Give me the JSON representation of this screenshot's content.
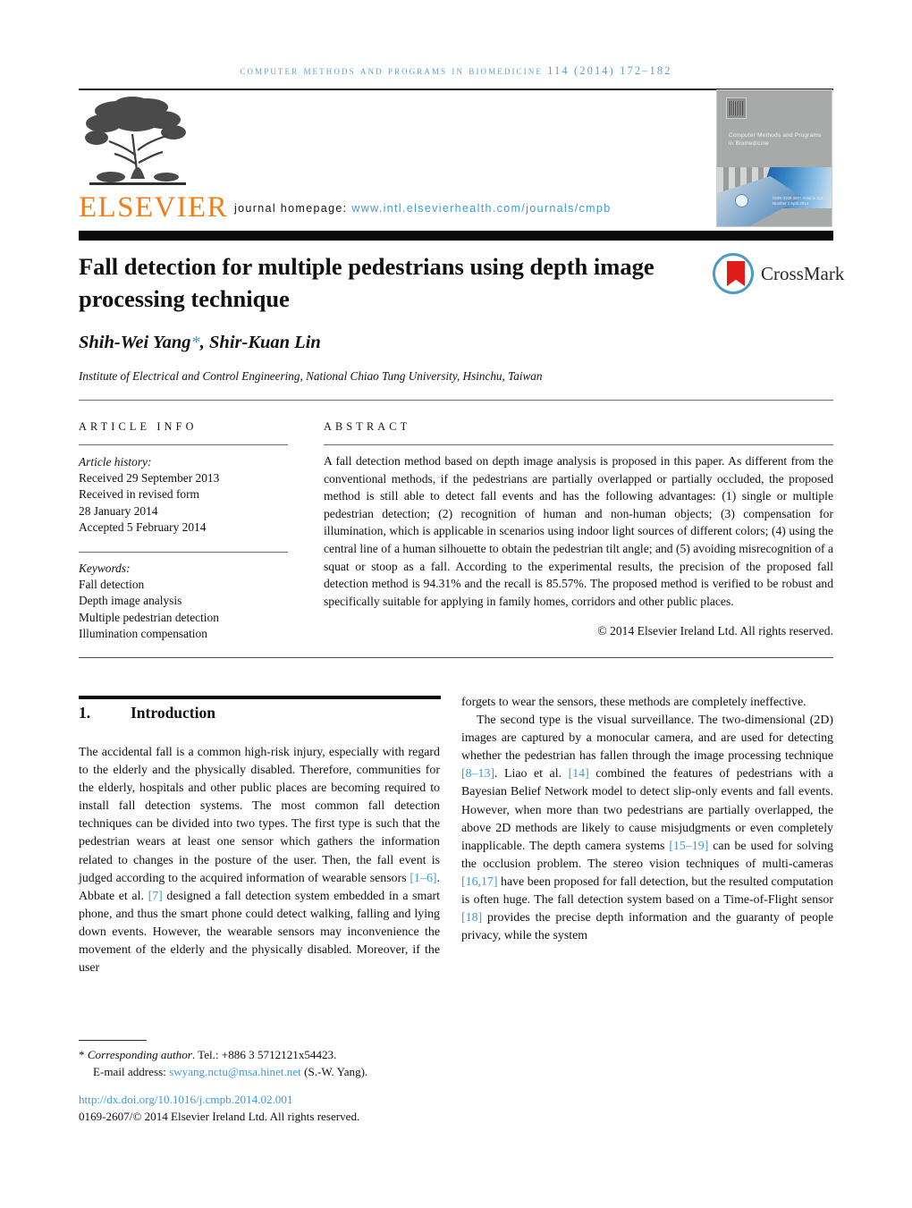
{
  "running_head": "Computer methods and programs in biomedicine 114 (2014) 172–182",
  "header": {
    "publisher": "ELSEVIER",
    "homepage_label": "journal homepage:",
    "homepage_url": "www.intl.elsevierhealth.com/journals/cmpb",
    "cover": {
      "title": "Computer Methods and Programs in Biomedicine",
      "footer": "ISSN 0169-2607 Volume 114 Number 1 April 2014"
    }
  },
  "article": {
    "title": "Fall detection for multiple pedestrians using depth image processing technique",
    "crossmark_label": "CrossMark",
    "authors": "Shih-Wei Yang",
    "authors_star": "*",
    "authors_rest": ", Shir-Kuan Lin",
    "affiliation": "Institute of Electrical and Control Engineering, National Chiao Tung University, Hsinchu, Taiwan"
  },
  "info": {
    "heading": "ARTICLE INFO",
    "history_label": "Article history:",
    "history": [
      "Received 29 September 2013",
      "Received in revised form",
      "28 January 2014",
      "Accepted 5 February 2014"
    ],
    "keywords_label": "Keywords:",
    "keywords": [
      "Fall detection",
      "Depth image analysis",
      "Multiple pedestrian detection",
      "Illumination compensation"
    ]
  },
  "abstract": {
    "heading": "ABSTRACT",
    "text": "A fall detection method based on depth image analysis is proposed in this paper. As different from the conventional methods, if the pedestrians are partially overlapped or partially occluded, the proposed method is still able to detect fall events and has the following advantages: (1) single or multiple pedestrian detection; (2) recognition of human and non-human objects; (3) compensation for illumination, which is applicable in scenarios using indoor light sources of different colors; (4) using the central line of a human silhouette to obtain the pedestrian tilt angle; and (5) avoiding misrecognition of a squat or stoop as a fall. According to the experimental results, the precision of the proposed fall detection method is 94.31% and the recall is 85.57%. The proposed method is verified to be robust and specifically suitable for applying in family homes, corridors and other public places.",
    "copyright": "© 2014 Elsevier Ireland Ltd. All rights reserved."
  },
  "body": {
    "section_number": "1.",
    "section_title": "Introduction",
    "left_text": "The accidental fall is a common high-risk injury, especially with regard to the elderly and the physically disabled. Therefore, communities for the elderly, hospitals and other public places are becoming required to install fall detection systems. The most common fall detection techniques can be divided into two types. The first type is such that the pedestrian wears at least one sensor which gathers the information related to changes in the posture of the user. Then, the fall event is judged according to the acquired information of wearable sensors ",
    "left_cite_1": "[1–6]",
    "left_text_2": ". Abbate et al. ",
    "left_cite_2": "[7]",
    "left_text_3": " designed a fall detection system embedded in a smart phone, and thus the smart phone could detect walking, falling and lying down events. However, the wearable sensors may inconvenience the movement of the elderly and the physically disabled. Moreover, if the user",
    "right_p1": "forgets to wear the sensors, these methods are completely ineffective.",
    "right_p2_a": "The second type is the visual surveillance. The two-dimensional (2D) images are captured by a monocular camera, and are used for detecting whether the pedestrian has fallen through the image processing technique ",
    "right_cite_1": "[8–13]",
    "right_p2_b": ". Liao et al. ",
    "right_cite_2": "[14]",
    "right_p2_c": " combined the features of pedestrians with a Bayesian Belief Network model to detect slip-only events and fall events. However, when more than two pedestrians are partially overlapped, the above 2D methods are likely to cause misjudgments or even completely inapplicable. The depth camera systems ",
    "right_cite_3": "[15–19]",
    "right_p2_d": " can be used for solving the occlusion problem. The stereo vision techniques of multi-cameras ",
    "right_cite_4": "[16,17]",
    "right_p2_e": " have been proposed for fall detection, but the resulted computation is often huge. The fall detection system based on a Time-of-Flight sensor ",
    "right_cite_5": "[18]",
    "right_p2_f": " provides the precise depth information and the guaranty of people privacy, while the system"
  },
  "footer": {
    "star": "*",
    "corresponding_label": "Corresponding author",
    "tel": ". Tel.: +886 3 5712121x54423.",
    "email_label": "E-mail address:",
    "email": "swyang.nctu@msa.hinet.net",
    "email_suffix": "(S.-W. Yang).",
    "doi": "http://dx.doi.org/10.1016/j.cmpb.2014.02.001",
    "issn_line": "0169-2607/© 2014 Elsevier Ireland Ltd. All rights reserved."
  },
  "colors": {
    "link_blue": "#3f9ad6",
    "elsevier_orange": "#f07d1a",
    "crossmark_red": "#e01b18",
    "crossmark_blue": "#4b9cc4"
  }
}
